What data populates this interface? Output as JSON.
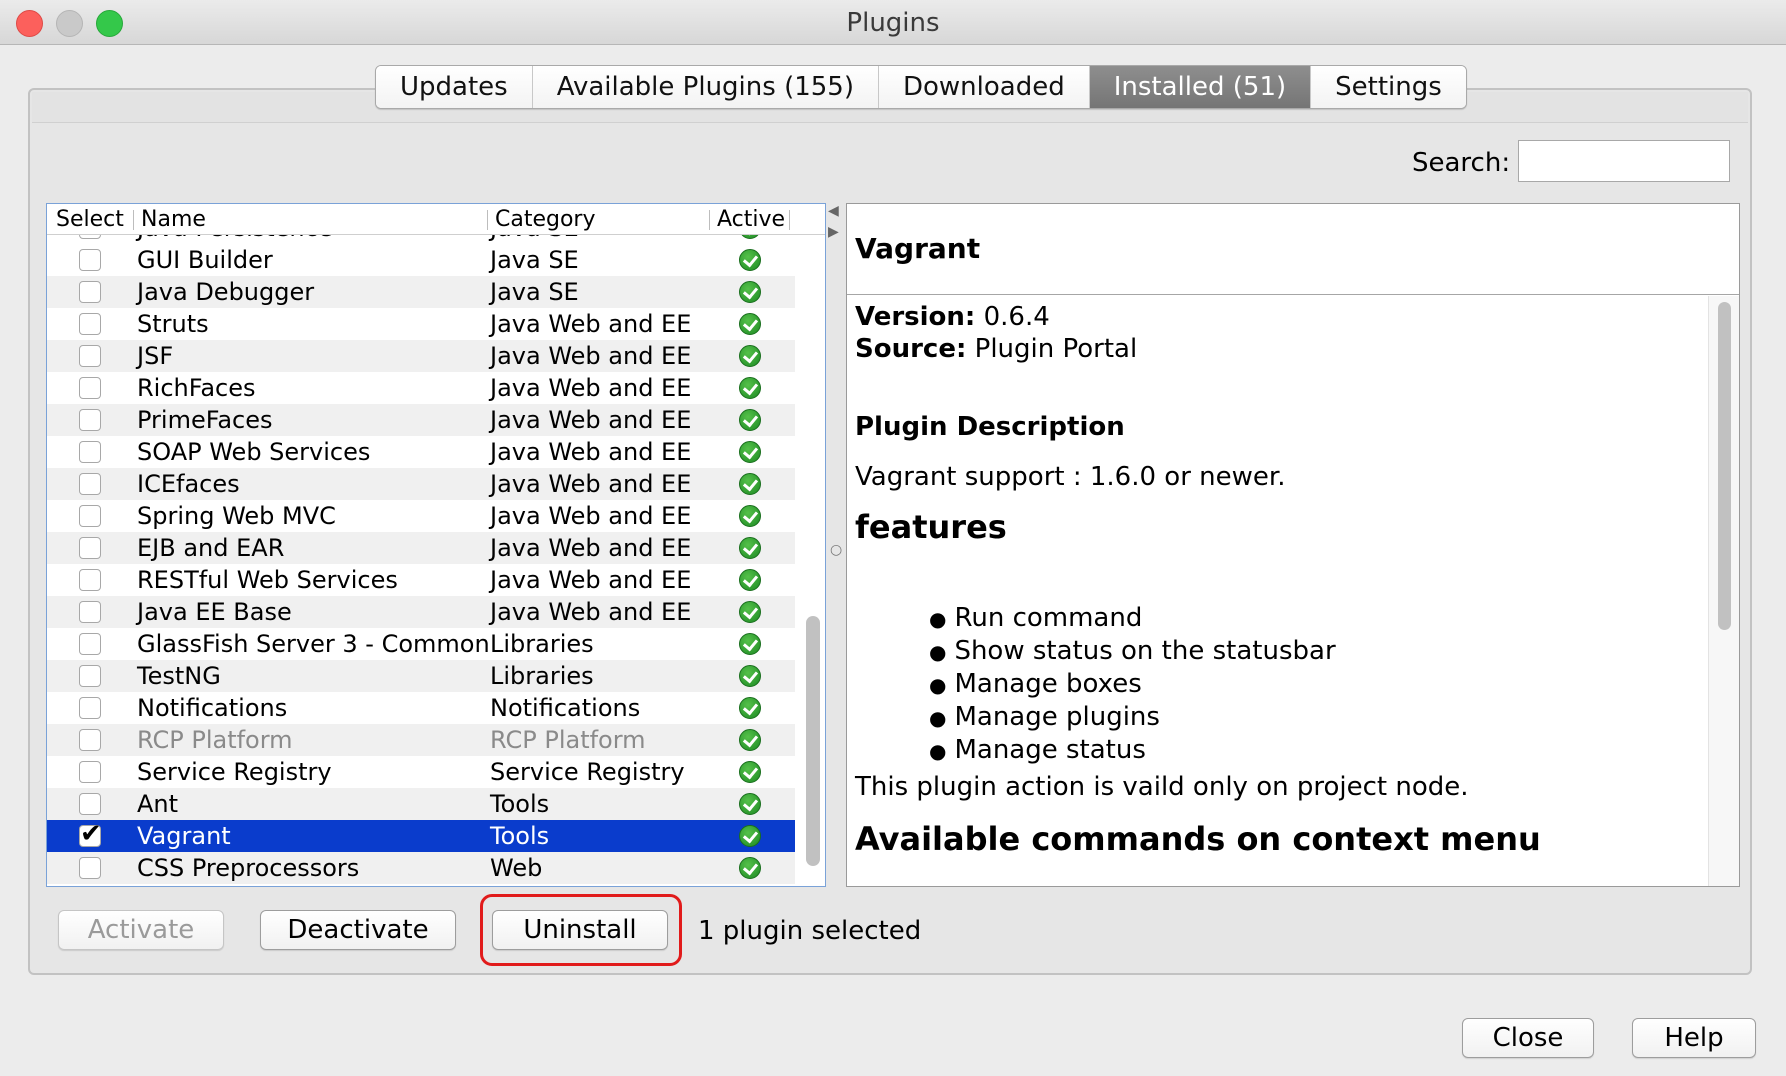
{
  "window": {
    "title": "Plugins"
  },
  "tabs": [
    {
      "label": "Updates",
      "active": false
    },
    {
      "label": "Available Plugins (155)",
      "active": false
    },
    {
      "label": "Downloaded",
      "active": false
    },
    {
      "label": "Installed (51)",
      "active": true
    },
    {
      "label": "Settings",
      "active": false
    }
  ],
  "search": {
    "label": "Search:",
    "value": ""
  },
  "table": {
    "headers": {
      "select": "Select",
      "name": "Name",
      "category": "Category",
      "active": "Active"
    },
    "partial_row": {
      "name": "Java Persistence",
      "category": "Java SE"
    },
    "rows": [
      {
        "name": "GUI Builder",
        "category": "Java SE",
        "checked": false
      },
      {
        "name": "Java Debugger",
        "category": "Java SE",
        "checked": false
      },
      {
        "name": "Struts",
        "category": "Java Web and EE",
        "checked": false
      },
      {
        "name": "JSF",
        "category": "Java Web and EE",
        "checked": false
      },
      {
        "name": "RichFaces",
        "category": "Java Web and EE",
        "checked": false
      },
      {
        "name": "PrimeFaces",
        "category": "Java Web and EE",
        "checked": false
      },
      {
        "name": "SOAP Web Services",
        "category": "Java Web and EE",
        "checked": false
      },
      {
        "name": "ICEfaces",
        "category": "Java Web and EE",
        "checked": false
      },
      {
        "name": "Spring Web MVC",
        "category": "Java Web and EE",
        "checked": false
      },
      {
        "name": "EJB and EAR",
        "category": "Java Web and EE",
        "checked": false
      },
      {
        "name": "RESTful Web Services",
        "category": "Java Web and EE",
        "checked": false
      },
      {
        "name": "Java EE Base",
        "category": "Java Web and EE",
        "checked": false
      },
      {
        "name": "GlassFish Server 3 - Common",
        "category": "Libraries",
        "checked": false
      },
      {
        "name": "TestNG",
        "category": "Libraries",
        "checked": false
      },
      {
        "name": "Notifications",
        "category": "Notifications",
        "checked": false
      },
      {
        "name": "RCP Platform",
        "category": "RCP Platform",
        "checked": false,
        "disabled": true
      },
      {
        "name": "Service Registry",
        "category": "Service Registry",
        "checked": false
      },
      {
        "name": "Ant",
        "category": "Tools",
        "checked": false
      },
      {
        "name": "Vagrant",
        "category": "Tools",
        "checked": true,
        "selected": true
      },
      {
        "name": "CSS Preprocessors",
        "category": "Web",
        "checked": false
      }
    ]
  },
  "detail": {
    "title": "Vagrant",
    "version_label": "Version:",
    "version_value": " 0.6.4",
    "source_label": "Source:",
    "source_value": " Plugin Portal",
    "description_heading": "Plugin Description",
    "support_text": "Vagrant support : 1.6.0 or newer.",
    "features_heading": "features",
    "features": [
      "Run command",
      "Show status on the statusbar",
      "Manage boxes",
      "Manage plugins",
      "Manage status"
    ],
    "note": "This plugin action is vaild only on project node.",
    "commands_heading": "Available commands on context menu"
  },
  "actions": {
    "activate": "Activate",
    "deactivate": "Deactivate",
    "uninstall": "Uninstall",
    "status": "1 plugin selected",
    "close": "Close",
    "help": "Help"
  },
  "colors": {
    "selection": "#0a3ccc",
    "highlight": "#e11b1b",
    "active_ok": "#1d8a23"
  }
}
